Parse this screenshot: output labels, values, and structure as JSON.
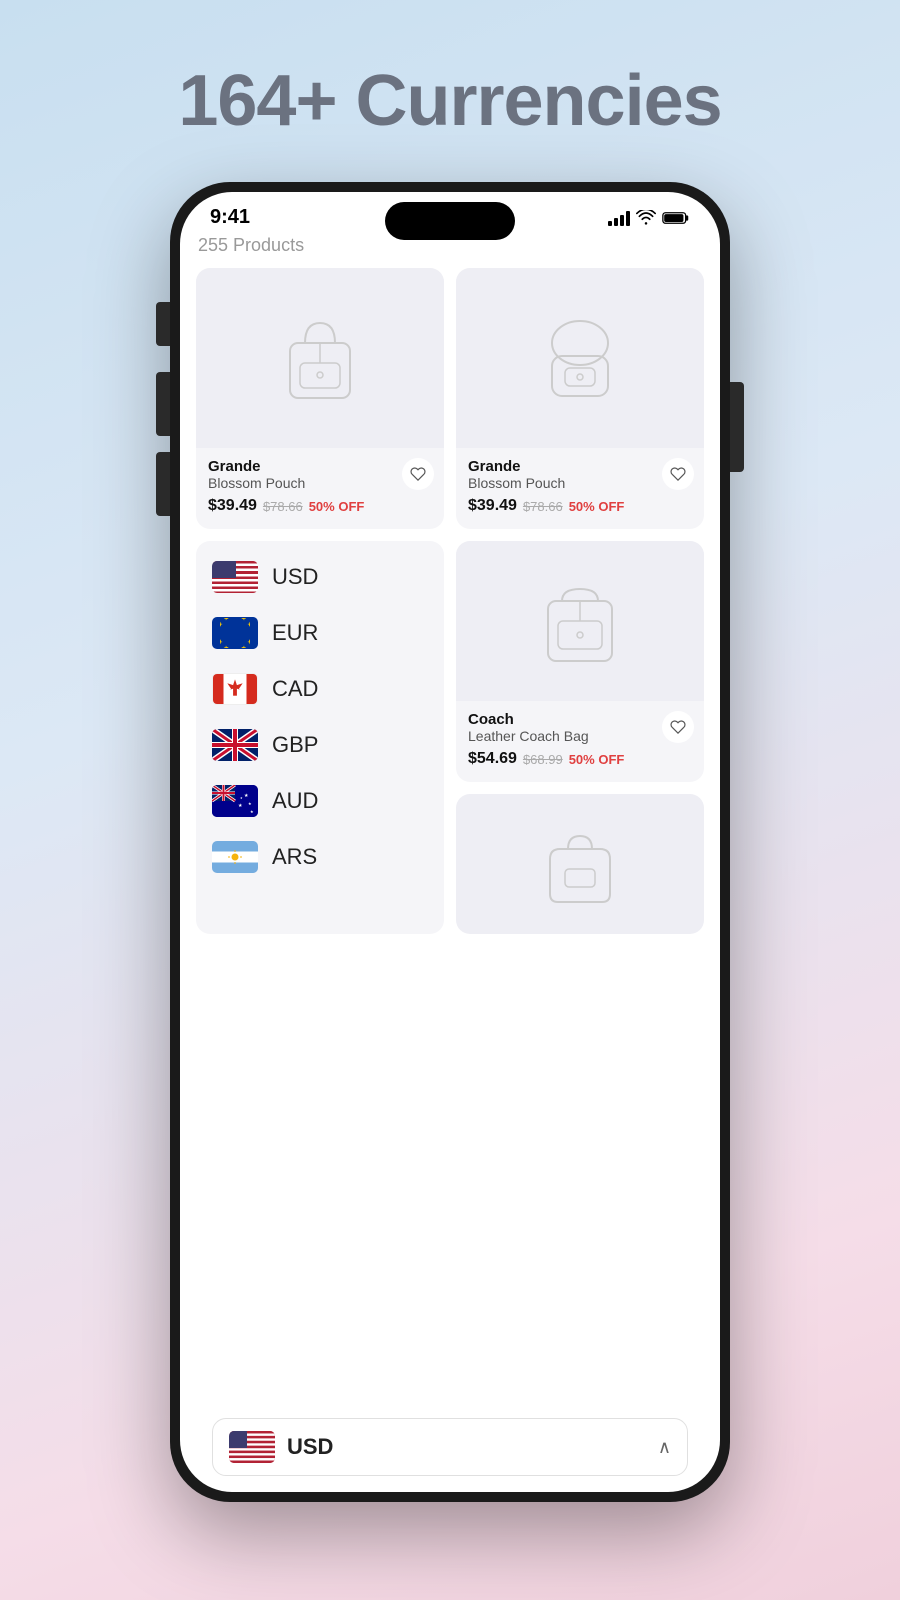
{
  "headline": "164+ Currencies",
  "status": {
    "time": "9:41"
  },
  "products_count": "255 Products",
  "products": [
    {
      "id": "p1",
      "brand": "Grande",
      "name": "Blossom Pouch",
      "price": "$39.49",
      "original_price": "$78.66",
      "discount": "50% OFF",
      "type": "backpack1"
    },
    {
      "id": "p2",
      "brand": "Grande",
      "name": "Blossom Pouch",
      "price": "$39.49",
      "original_price": "$78.66",
      "discount": "50% OFF",
      "type": "backpack2"
    },
    {
      "id": "p3",
      "brand": "Coach",
      "name": "Leather Coach Bag",
      "price": "$54.69",
      "original_price": "$68.99",
      "discount": "50% OFF",
      "type": "bag1"
    },
    {
      "id": "p4",
      "brand": "",
      "name": "",
      "price": "",
      "original_price": "",
      "discount": "",
      "type": "bag2"
    }
  ],
  "currencies": [
    {
      "code": "USD",
      "flag": "usd",
      "emoji": "🇺🇸"
    },
    {
      "code": "EUR",
      "flag": "eur",
      "emoji": "🇪🇺"
    },
    {
      "code": "CAD",
      "flag": "cad",
      "emoji": "🇨🇦"
    },
    {
      "code": "GBP",
      "flag": "gbp",
      "emoji": "🇬🇧"
    },
    {
      "code": "AUD",
      "flag": "aud",
      "emoji": "🇦🇺"
    },
    {
      "code": "ARS",
      "flag": "ars",
      "emoji": "🇦🇷"
    }
  ],
  "selected_currency": {
    "code": "USD",
    "emoji": "🇺🇸"
  },
  "bottom_bar": {
    "currency_label": "USD",
    "chevron": "∧"
  }
}
